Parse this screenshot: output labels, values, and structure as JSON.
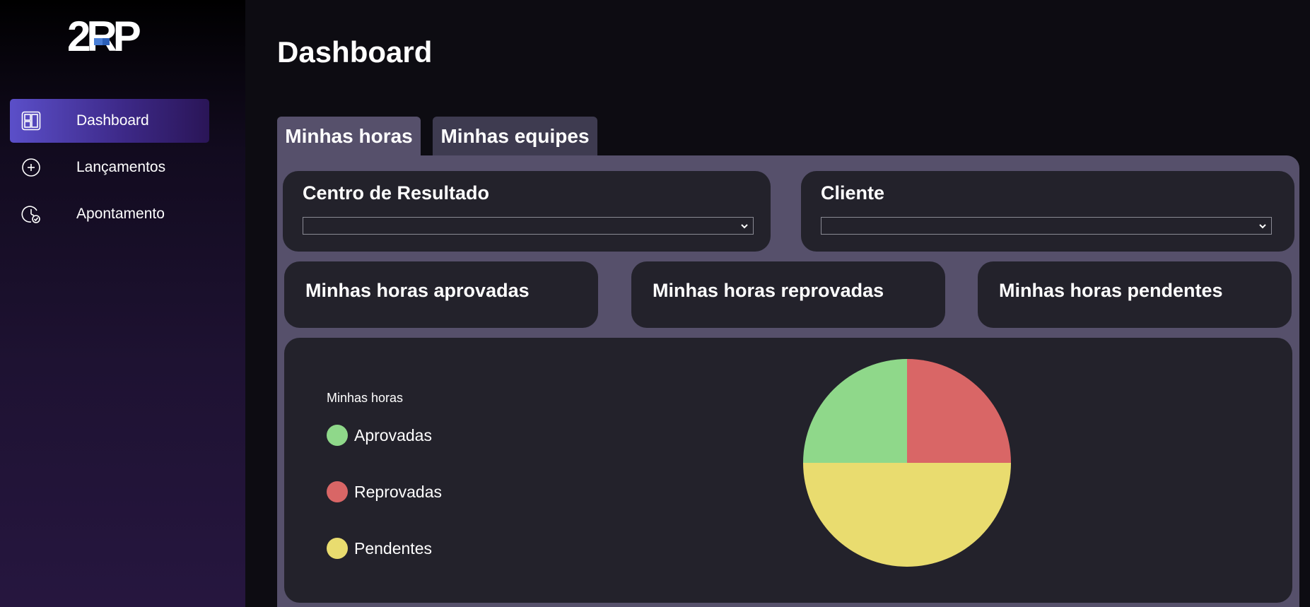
{
  "sidebar": {
    "logo_text": "2RP",
    "items": [
      {
        "label": "Dashboard",
        "icon": "dashboard-icon",
        "active": true
      },
      {
        "label": "Lançamentos",
        "icon": "plus-circle-icon",
        "active": false
      },
      {
        "label": "Apontamento",
        "icon": "clock-check-icon",
        "active": false
      }
    ]
  },
  "page": {
    "title": "Dashboard"
  },
  "tabs": [
    {
      "label": "Minhas horas",
      "active": true
    },
    {
      "label": "Minhas equipes",
      "active": false
    }
  ],
  "filters": {
    "centro": {
      "label": "Centro de Resultado",
      "value": ""
    },
    "cliente": {
      "label": "Cliente",
      "value": ""
    }
  },
  "stats": {
    "aprovadas": "Minhas horas aprovadas",
    "reprovadas": "Minhas horas reprovadas",
    "pendentes": "Minhas horas pendentes"
  },
  "chart_data": {
    "type": "pie",
    "title": "Minhas horas",
    "legend_placement": "left",
    "series": [
      {
        "name": "Aprovadas",
        "value": 25,
        "color": "#8fd88a"
      },
      {
        "name": "Reprovadas",
        "value": 25,
        "color": "#d96666"
      },
      {
        "name": "Pendentes",
        "value": 50,
        "color": "#e9dc6f"
      }
    ]
  },
  "colors": {
    "accent": "#5b4fc9",
    "card": "#23222b",
    "panel": "#56506b"
  }
}
